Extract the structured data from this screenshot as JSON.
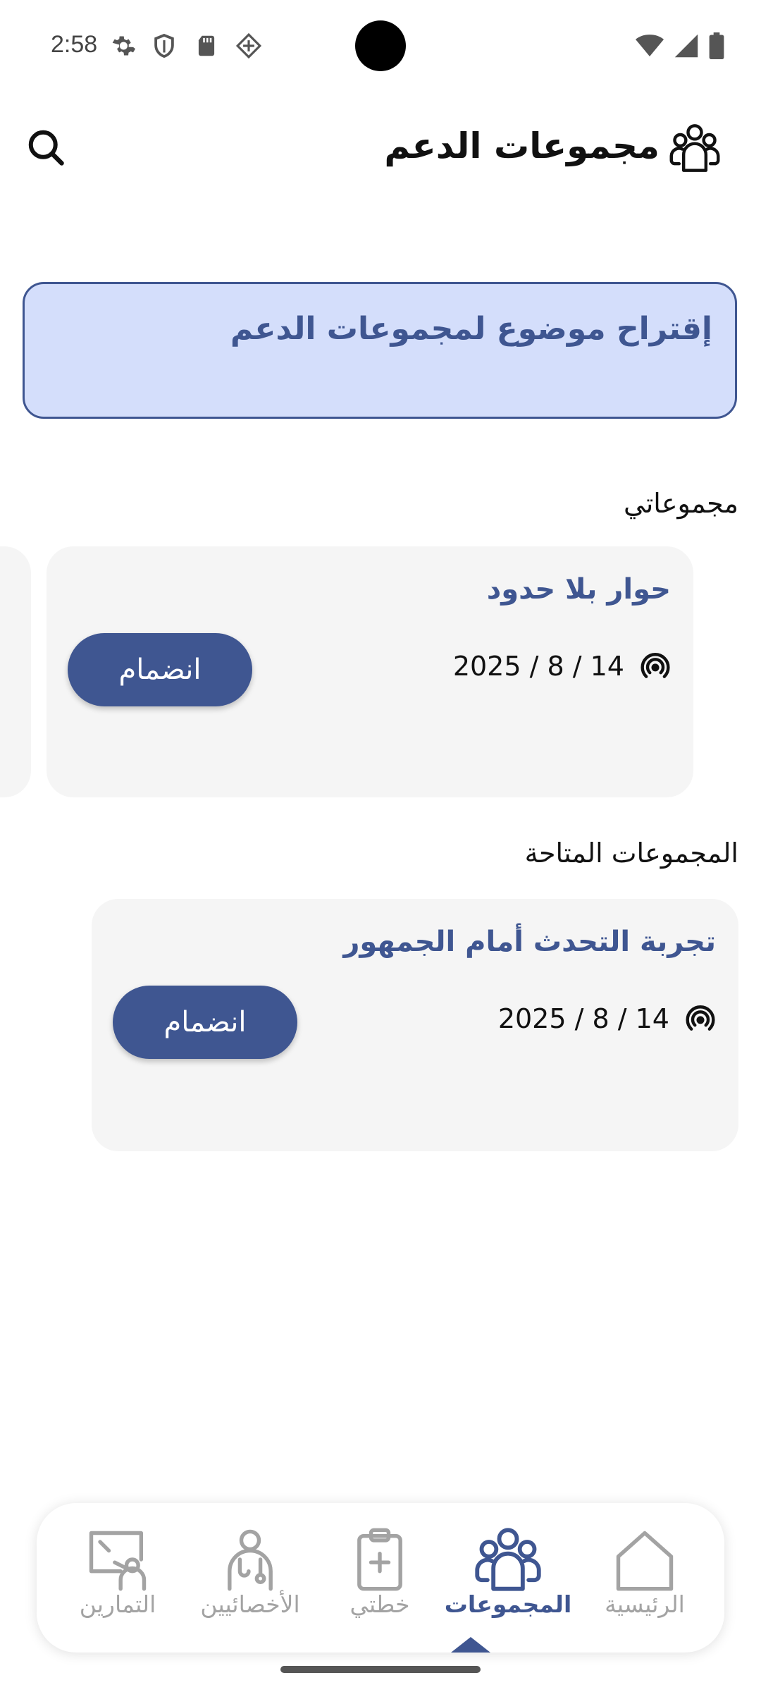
{
  "status_bar": {
    "time": "2:58",
    "left_icons": [
      "gear-icon",
      "shield-icon",
      "sd-card-icon",
      "gamepad-icon"
    ],
    "right_icons": [
      "wifi-icon",
      "signal-icon",
      "battery-icon"
    ]
  },
  "header": {
    "title": "مجموعات الدعم",
    "icon": "groups-icon",
    "search_icon": "search-icon"
  },
  "suggest": {
    "label": "إقتراح موضوع لمجموعات الدعم"
  },
  "my_groups": {
    "title": "مجموعاتي",
    "items": [
      {
        "name": "حوار بلا حدود",
        "date": "2025 / 8 / 14",
        "join_label": "انضمام"
      }
    ]
  },
  "available_groups": {
    "title": "المجموعات المتاحة",
    "items": [
      {
        "name": "تجربة التحدث أمام الجمهور",
        "date": "2025 / 8 / 14",
        "join_label": "انضمام"
      }
    ]
  },
  "bottom_nav": {
    "items": [
      {
        "label": "التمارين",
        "icon": "exercise-board-icon",
        "active": false
      },
      {
        "label": "الأخصائيين",
        "icon": "doctor-icon",
        "active": false
      },
      {
        "label": "خطتي",
        "icon": "clipboard-plus-icon",
        "active": false
      },
      {
        "label": "المجموعات",
        "icon": "groups-icon",
        "active": true
      },
      {
        "label": "الرئيسية",
        "icon": "home-icon",
        "active": false
      }
    ]
  },
  "colors": {
    "accent": "#3f5691",
    "suggest_bg": "#d4defb",
    "card_bg": "#f5f5f5",
    "inactive_nav": "#a3a3a3"
  }
}
